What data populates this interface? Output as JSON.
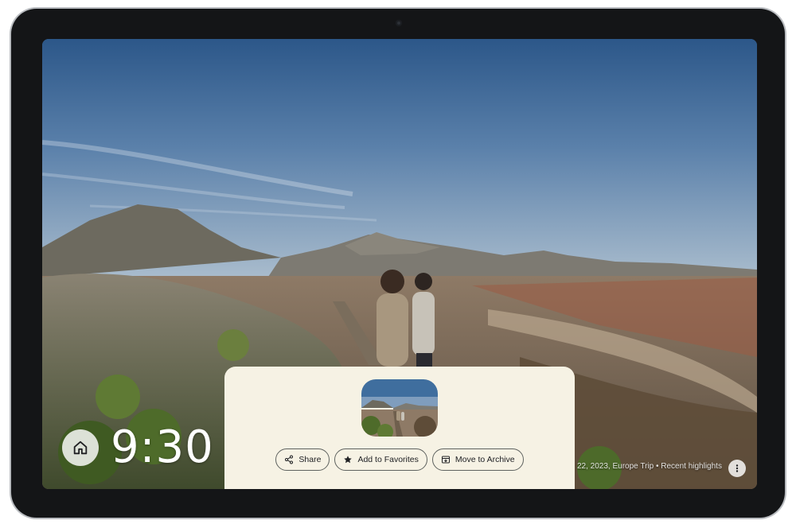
{
  "clock": {
    "time": "9:30"
  },
  "photo": {
    "caption": "22, 2023, Europe Trip • Recent highlights"
  },
  "actions": [
    {
      "label": "Share",
      "icon": "share-icon"
    },
    {
      "label": "Add to Favorites",
      "icon": "star-icon"
    },
    {
      "label": "Move to Archive",
      "icon": "archive-icon"
    }
  ],
  "icons": {
    "home": "home-icon",
    "more": "more-vertical-icon"
  },
  "colors": {
    "sheet_background": "#f6f2e4",
    "chip_border": "#5f6360",
    "device_bezel": "#141517",
    "device_frame": "#b9bcc0"
  }
}
